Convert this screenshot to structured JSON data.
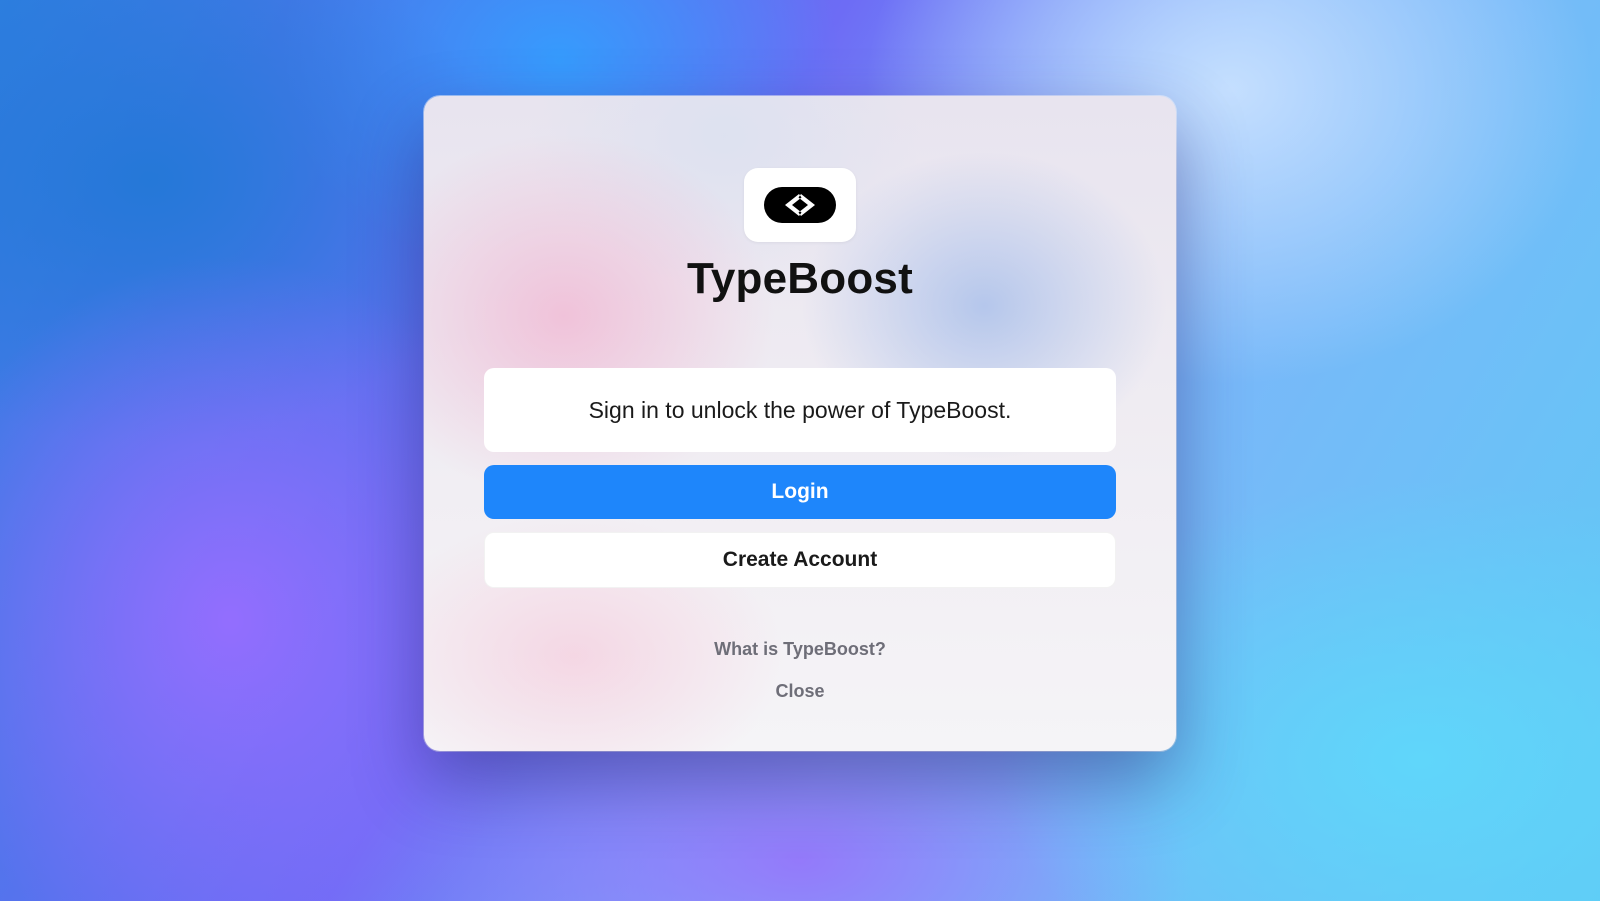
{
  "app": {
    "name": "TypeBoost",
    "logo_icon": "code-brackets-logo-icon"
  },
  "dialog": {
    "message": "Sign in to unlock the power of TypeBoost.",
    "login_label": "Login",
    "create_account_label": "Create Account",
    "what_is_label": "What is TypeBoost?",
    "close_label": "Close"
  },
  "colors": {
    "primary_button": "#1e86fb",
    "title_text": "#111111",
    "link_text": "#6e6e78"
  }
}
